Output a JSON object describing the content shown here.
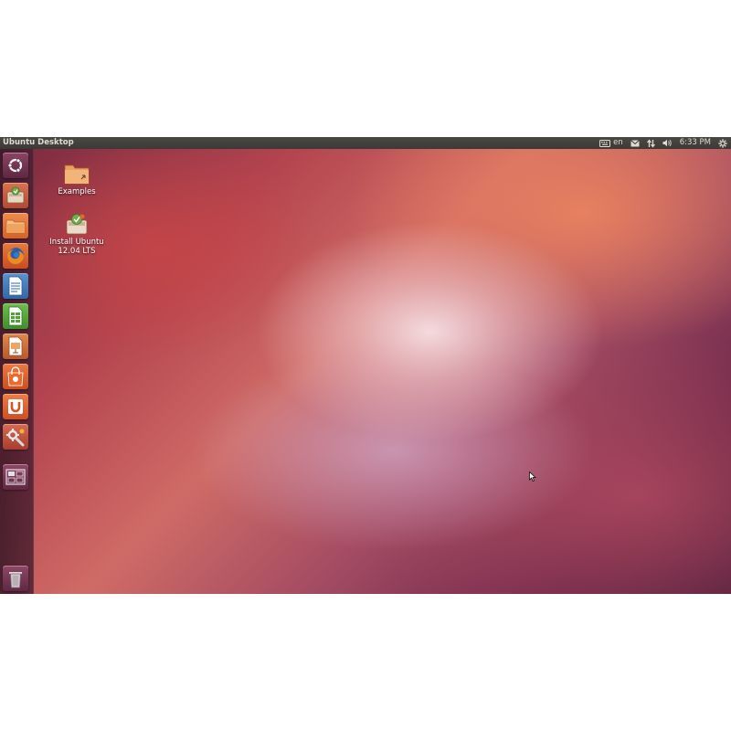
{
  "panel": {
    "title": "Ubuntu Desktop",
    "keyboard_layout": "en",
    "clock": "6:33 PM",
    "icons": [
      "keyboard-icon",
      "mail-icon",
      "network-icon",
      "volume-icon",
      "gear-icon"
    ]
  },
  "launcher": {
    "items": [
      {
        "name": "dash-home",
        "icon": "ubuntu-logo-icon",
        "color": "#6a2d4a"
      },
      {
        "name": "installer",
        "icon": "installer-icon",
        "color": "#c0563b"
      },
      {
        "name": "files",
        "icon": "folder-icon",
        "color": "#e06a2c"
      },
      {
        "name": "firefox",
        "icon": "firefox-icon",
        "color": "#d8592a"
      },
      {
        "name": "writer",
        "icon": "document-icon",
        "color": "#3a76b8"
      },
      {
        "name": "calc",
        "icon": "spreadsheet-icon",
        "color": "#4ea336"
      },
      {
        "name": "impress",
        "icon": "presentation-icon",
        "color": "#c56a2c"
      },
      {
        "name": "software-center",
        "icon": "shopping-bag-icon",
        "color": "#d55b2a"
      },
      {
        "name": "ubuntu-one",
        "icon": "ubuntu-one-icon",
        "color": "#d4532a"
      },
      {
        "name": "system-settings",
        "icon": "wrench-icon",
        "color": "#c04a3a"
      },
      {
        "name": "workspace-switcher",
        "icon": "workspaces-icon",
        "color": "#7a3552"
      },
      {
        "name": "trash",
        "icon": "trash-icon",
        "color": "#7a3552"
      }
    ]
  },
  "desktop": {
    "icons": [
      {
        "label": "Examples",
        "icon": "folder-icon"
      },
      {
        "label": "Install Ubuntu 12.04 LTS",
        "icon": "installer-icon"
      }
    ]
  },
  "colors": {
    "panel": "#3c3b37",
    "panel_text": "#dfdbd2",
    "accent": "#dd4814"
  }
}
